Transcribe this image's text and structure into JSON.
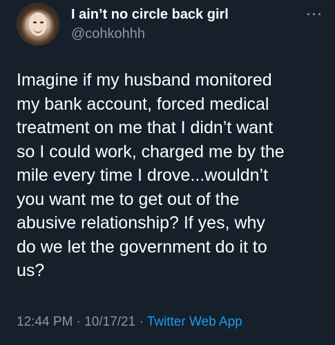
{
  "author": {
    "display_name": "I ain’t no circle back girl",
    "handle": "@cohkohhh",
    "avatar_icon": "profile-photo"
  },
  "more_icon": "more-dots-icon",
  "tweet": {
    "text": "Imagine if my husband monitored\nmy bank account, forced medical\ntreatment on me that I didn’t want\nso I could work, charged me by the\nmile every time I drove...wouldn’t\nyou want me to get out of the\nabusive relationship? If yes, why\ndo we let the government do it to\nus?"
  },
  "meta": {
    "time": "12:44 PM",
    "separator": "·",
    "date": "10/17/21",
    "app": "Twitter Web App"
  },
  "colors": {
    "background": "#15202b",
    "text": "#ffffff",
    "secondary": "#8b98a5",
    "accent": "#1d9bf0"
  }
}
